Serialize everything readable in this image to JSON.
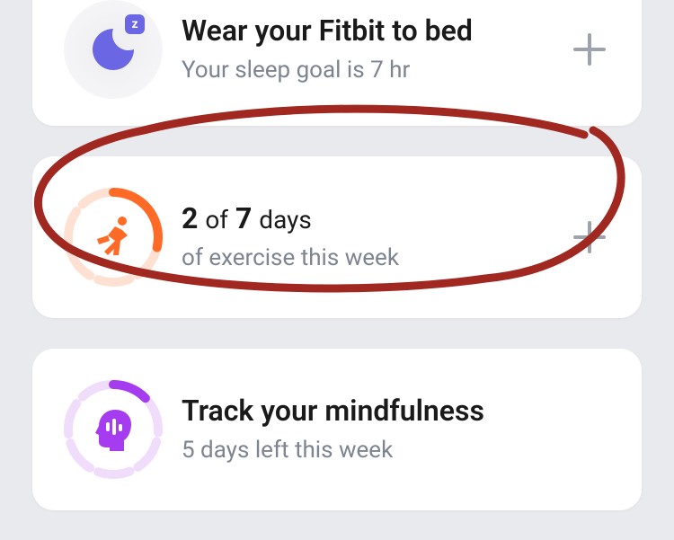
{
  "sleep": {
    "title": "Wear your Fitbit to bed",
    "subtitle": "Your sleep goal is 7 hr",
    "icon_name": "moon-z",
    "icon_color": "#6b66e4"
  },
  "exercise": {
    "current": "2",
    "of": "of",
    "total": "7",
    "unit": "days",
    "subtitle": "of exercise this week",
    "icon_name": "running",
    "icon_color": "#ff6b27",
    "ring_track": "#ffe6dc",
    "progress_ratio": 0.2857
  },
  "mindfulness": {
    "title": "Track your mindfulness",
    "subtitle": "5 days left this week",
    "icon_name": "head-mind",
    "icon_color": "#a63cf0",
    "ring_track": "#f0dcfb"
  },
  "add_label": "+",
  "annotation_color": "#a02820"
}
